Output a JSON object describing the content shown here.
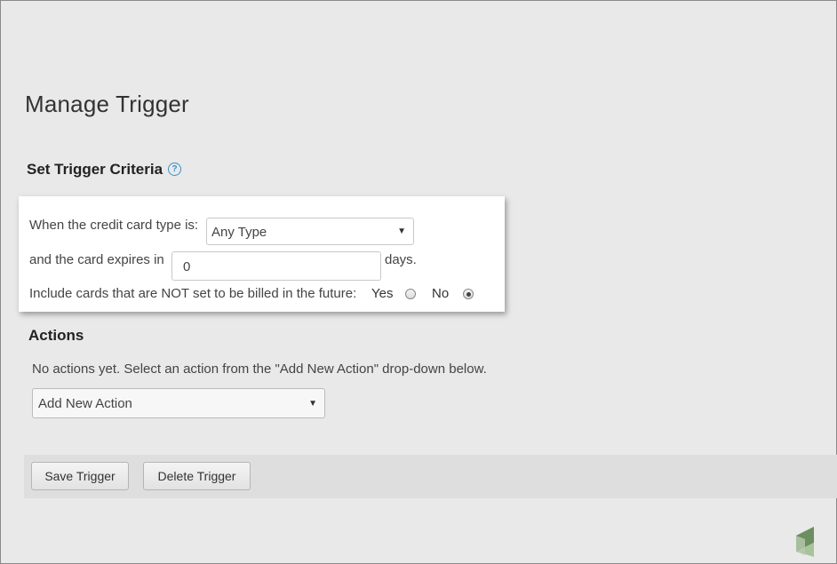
{
  "page": {
    "title": "Manage Trigger"
  },
  "criteria": {
    "section_title": "Set Trigger Criteria",
    "help_icon": "question-circle-icon",
    "card_type_label": "When the credit card type is:",
    "card_type_value": "Any Type",
    "expires_label_before": "and the card expires in",
    "expires_value": "0",
    "expires_label_after": "days.",
    "include_label": "Include cards that are NOT set to be billed in the future:",
    "yes_label": "Yes",
    "no_label": "No",
    "include_selected": "No"
  },
  "actions": {
    "title": "Actions",
    "empty_text": "No actions yet. Select an action from the \"Add New Action\" drop-down below.",
    "add_select_value": "Add New Action"
  },
  "buttons": {
    "save_label": "Save Trigger",
    "delete_label": "Delete Trigger"
  },
  "colors": {
    "help_icon": "#3a8fc9",
    "logo_dark": "#6b8f5e",
    "logo_light": "#a9c39a"
  }
}
